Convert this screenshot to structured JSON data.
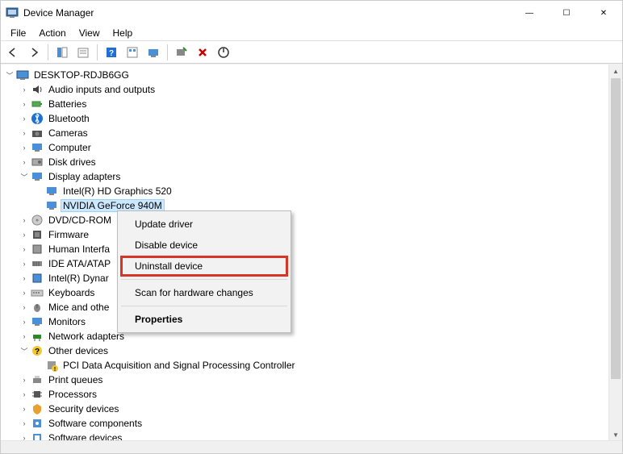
{
  "window": {
    "title": "Device Manager",
    "controls": {
      "min": "—",
      "max": "☐",
      "close": "✕"
    }
  },
  "menu": {
    "file": "File",
    "action": "Action",
    "view": "View",
    "help": "Help"
  },
  "tree": {
    "root": "DESKTOP-RDJB6GG",
    "nodes": {
      "audio": "Audio inputs and outputs",
      "batteries": "Batteries",
      "bluetooth": "Bluetooth",
      "cameras": "Cameras",
      "computer": "Computer",
      "disk": "Disk drives",
      "display": "Display adapters",
      "display_intel": "Intel(R) HD Graphics 520",
      "display_nvidia": "NVIDIA GeForce 940M",
      "dvd": "DVD/CD-ROM",
      "firmware": "Firmware",
      "hid": "Human Interfa",
      "ide": "IDE ATA/ATAP",
      "intel_dynam": "Intel(R) Dynar",
      "keyboards": "Keyboards",
      "mice": "Mice and othe",
      "monitors": "Monitors",
      "network": "Network adapters",
      "other": "Other devices",
      "pci_daq": "PCI Data Acquisition and Signal Processing Controller",
      "printq": "Print queues",
      "processors": "Processors",
      "security": "Security devices",
      "swcomp": "Software components",
      "swdev": "Software devices"
    }
  },
  "context_menu": {
    "update": "Update driver",
    "disable": "Disable device",
    "uninstall": "Uninstall device",
    "scan": "Scan for hardware changes",
    "properties": "Properties"
  },
  "toolbar_icons": {
    "back": "back-icon",
    "forward": "forward-icon",
    "show_hide": "show-hide-tree-icon",
    "properties": "properties-icon",
    "help": "help-icon",
    "scan": "scan-hardware-icon",
    "update": "update-driver-icon",
    "enable": "enable-device-icon",
    "uninstall": "uninstall-device-icon",
    "show_hidden": "show-hidden-icon"
  }
}
